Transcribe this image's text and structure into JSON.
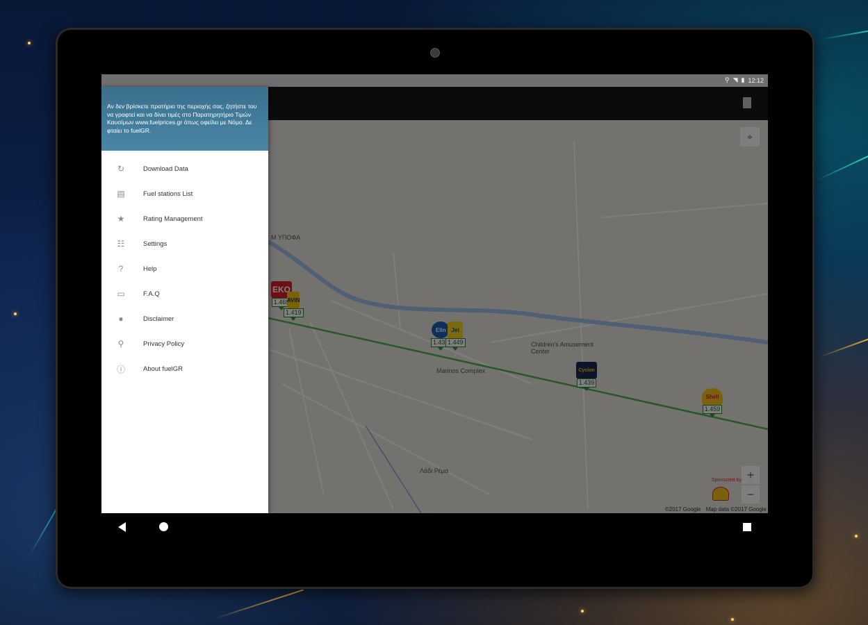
{
  "status_bar": {
    "time": "12:12"
  },
  "drawer": {
    "header_text": "Αν δεν βρίσκετε πρατήριο της περιοχής σας, ζητήστε του να γραφτεί και να δίνει τιμές στο Παρατηρητήριο Τιμών Καυσίμων www.fuelprices.gr όπως οφείλει με Νόμο. Δε φταίει το fuelGR.",
    "items": [
      {
        "label": "Download Data",
        "icon": "refresh-icon"
      },
      {
        "label": "Fuel stations List",
        "icon": "list-icon"
      },
      {
        "label": "Rating Management",
        "icon": "star-icon"
      },
      {
        "label": "Settings",
        "icon": "settings-sliders-icon"
      },
      {
        "label": "Help",
        "icon": "help-icon"
      },
      {
        "label": "F.A.Q",
        "icon": "chat-icon"
      },
      {
        "label": "Disclaimer",
        "icon": "disclaimer-icon"
      },
      {
        "label": "Privacy Policy",
        "icon": "location-pin-icon"
      },
      {
        "label": "About fuelGR",
        "icon": "info-icon"
      }
    ]
  },
  "map": {
    "poi_children": "Children's Amusement Center",
    "poi_marinos": "Marinos Complex",
    "poi_area": "Μ ΥΠΟΦΑ",
    "poi_bottom": "Λάδι Ρέμα",
    "zoom_in": "+",
    "zoom_out": "−",
    "sponsored": "Sponsored by",
    "attribution": "©2017 Google · Map data ©2017 Google",
    "stations": [
      {
        "brand": "EKO",
        "price": "1.469"
      },
      {
        "brand": "AVIN",
        "price": "1.419"
      },
      {
        "brand": "Elin",
        "price": "1.439"
      },
      {
        "brand": "Jet",
        "price": "1.449"
      },
      {
        "brand": "Cyclon",
        "price": "1.439"
      },
      {
        "brand": "Shell",
        "price": "1.459"
      }
    ]
  },
  "colors": {
    "drawer_header": "#3b6f8e",
    "price_green": "#2a9a2a",
    "shell_yellow": "#f6c21a"
  }
}
